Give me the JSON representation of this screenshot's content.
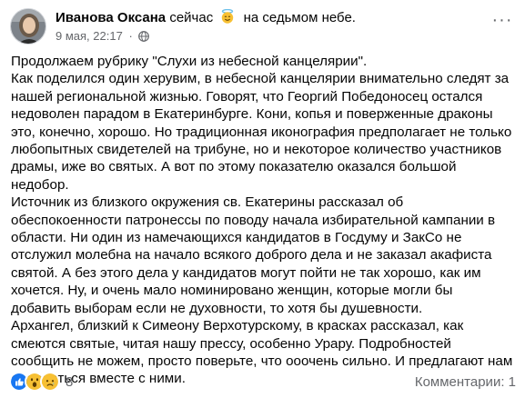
{
  "post": {
    "author": "Иванова Оксана",
    "feeling_prefix": "сейчас",
    "feeling_text": "на седьмом небе.",
    "date": "9 мая, 22:17",
    "separator": "·",
    "more_label": "···",
    "feeling_icon": "smiling-face-with-halo-icon",
    "privacy_icon": "globe-icon",
    "text": "Продолжаем рубрику \"Слухи из небесной канцелярии\".\nКак поделился один херувим, в небесной канцелярии внимательно следят за нашей региональной жизнью. Говорят, что Георгий Победоносец остался недоволен парадом в Екатеринбурге. Кони, копья и поверженные драконы это, конечно, хорошо. Но традиционная иконография предполагает не только любопытных свидетелей на трибуне, но и некоторое количество участников драмы, иже во святых. А вот по этому показателю оказался большой недобор.\nИсточник из близкого окружения св. Екатерины рассказал об обеспокоенности патронессы по поводу начала избирательной кампании в области. Ни один из намечающихся кандидатов в Госдуму и ЗакСо не отслужил молебна на начало всякого доброго дела и не заказал акафиста святой. А без этого дела у кандидатов могут пойти не так хорошо, как им хочется. Ну, и очень мало номинировано женщин, которые могли бы добавить выборам если не духовности, то хотя бы душевности.\nАрхангел, близкий к Симеону Верхотурскому, в красках рассказал, как смеются святые, читая нашу прессу, особенно Урару. Подробностей сообщить не можем, просто поверьте, что ооочень сильно. И предлагают нам посмеяться вместе с ними."
  },
  "footer": {
    "reactions": [
      "like-reaction-icon",
      "wow-reaction-icon",
      "sad-reaction-icon"
    ],
    "reaction_count": "8",
    "comments": "Комментарии: 1"
  },
  "colors": {
    "like": "#1877f2",
    "emoji": "#f7c033",
    "muted": "#65676b"
  }
}
